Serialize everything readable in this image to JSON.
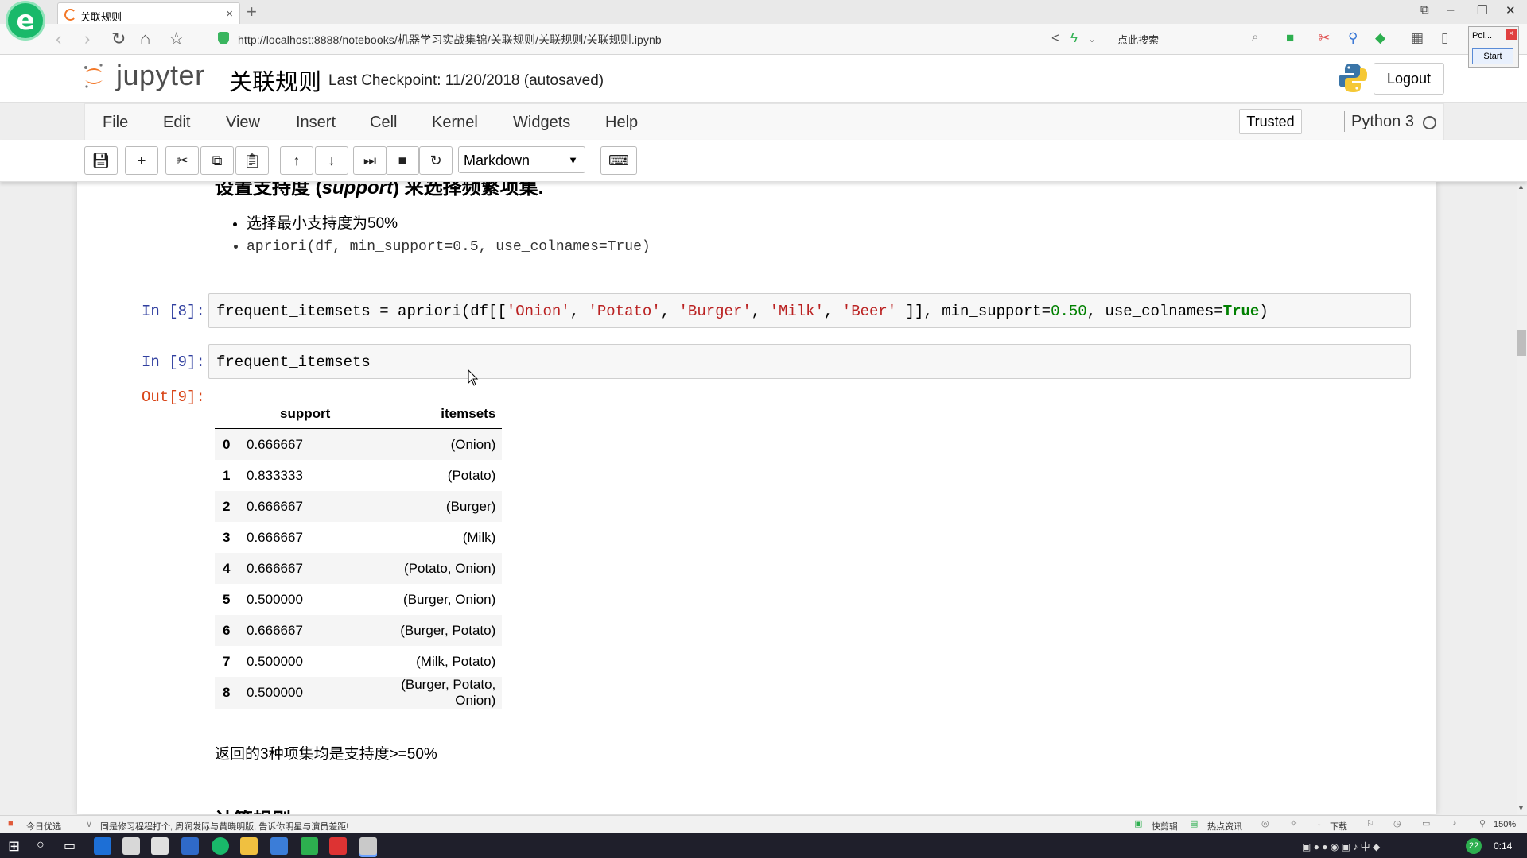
{
  "browser": {
    "tab_title": "关联规则",
    "url": "http://localhost:8888/notebooks/机器学习实战集锦/关联规则/关联规则/关联规则.ipynb",
    "search_placeholder": "点此搜索",
    "popup_title": "Poi...",
    "popup_start": "Start"
  },
  "jupyter": {
    "logo_text": "jupyter",
    "notebook_title": "关联规则",
    "checkpoint": "Last Checkpoint: 11/20/2018 (autosaved)",
    "logout_label": "Logout",
    "menu": [
      "File",
      "Edit",
      "View",
      "Insert",
      "Cell",
      "Kernel",
      "Widgets",
      "Help"
    ],
    "trusted_label": "Trusted",
    "kernel_name": "Python 3",
    "cell_type": "Markdown"
  },
  "notebook": {
    "md_heading_pre": "设置支持度 (",
    "md_heading_em": "support",
    "md_heading_post": ") 来选择频繁项集.",
    "bullets": [
      "选择最小支持度为50%",
      "apriori(df, min_support=0.5, use_colnames=True)"
    ],
    "cell8": {
      "prompt": "In [8]:",
      "code": {
        "p1": "frequent_itemsets = apriori(df[[",
        "s1": "'Onion'",
        "p2": ", ",
        "s2": "'Potato'",
        "p3": ", ",
        "s3": "'Burger'",
        "p4": ", ",
        "s4": "'Milk'",
        "p5": ", ",
        "s5": "'Beer'",
        "p6": " ]], min_support=",
        "num": "0.50",
        "p7": ", use_colnames=",
        "kw": "True",
        "p8": ")"
      }
    },
    "cell9": {
      "prompt": "In [9]:",
      "code": "frequent_itemsets",
      "out_prompt": "Out[9]:"
    },
    "table": {
      "columns": [
        "",
        "support",
        "itemsets"
      ],
      "rows": [
        [
          "0",
          "0.666667",
          "(Onion)"
        ],
        [
          "1",
          "0.833333",
          "(Potato)"
        ],
        [
          "2",
          "0.666667",
          "(Burger)"
        ],
        [
          "3",
          "0.666667",
          "(Milk)"
        ],
        [
          "4",
          "0.666667",
          "(Potato, Onion)"
        ],
        [
          "5",
          "0.500000",
          "(Burger, Onion)"
        ],
        [
          "6",
          "0.666667",
          "(Burger, Potato)"
        ],
        [
          "7",
          "0.500000",
          "(Milk, Potato)"
        ],
        [
          "8",
          "0.500000",
          "(Burger, Potato, Onion)"
        ]
      ]
    },
    "summary": "返回的3种项集均是支持度>=50%",
    "next_heading": "计算规则"
  },
  "statusbar": {
    "left_label": "今日优选",
    "news": "同是修习程程打个, 周润发际与黄晓明版, 告诉你明星与演员差距!",
    "items": [
      "快剪辑",
      "热点资讯",
      "下载",
      "150%"
    ]
  },
  "taskbar": {
    "clock": "0:14",
    "badge": "22"
  }
}
